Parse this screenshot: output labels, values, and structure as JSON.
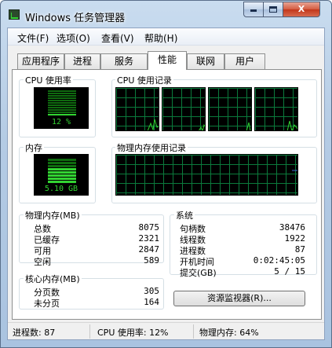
{
  "window": {
    "title": "Windows 任务管理器",
    "controls": {
      "minimize": "minimize",
      "maximize": "maximize",
      "close": "X"
    }
  },
  "menu": [
    "文件(F)",
    "选项(O)",
    "查看(V)",
    "帮助(H)"
  ],
  "tabs": [
    "应用程序",
    "进程",
    "服务",
    "性能",
    "联网",
    "用户"
  ],
  "active_tab": "性能",
  "cpu_usage": {
    "title": "CPU 使用率",
    "value": "12 %",
    "percent": 12
  },
  "cpu_history": {
    "title": "CPU 使用记录"
  },
  "memory": {
    "title": "内存",
    "value": "5.10 GB",
    "percent": 64
  },
  "memory_history": {
    "title": "物理内存使用记录"
  },
  "physical_memory": {
    "title": "物理内存(MB)",
    "rows": [
      {
        "label": "总数",
        "value": "8075"
      },
      {
        "label": "已缓存",
        "value": "2321"
      },
      {
        "label": "可用",
        "value": "2847"
      },
      {
        "label": "空闲",
        "value": "589"
      }
    ]
  },
  "kernel_memory": {
    "title": "核心内存(MB)",
    "rows": [
      {
        "label": "分页数",
        "value": "305"
      },
      {
        "label": "未分页",
        "value": "164"
      }
    ]
  },
  "system": {
    "title": "系统",
    "rows": [
      {
        "label": "句柄数",
        "value": "38476"
      },
      {
        "label": "线程数",
        "value": "1922"
      },
      {
        "label": "进程数",
        "value": "87"
      },
      {
        "label": "开机时间",
        "value": "0:02:45:05"
      },
      {
        "label": "提交(GB)",
        "value": "5 / 15"
      }
    ]
  },
  "resource_monitor_button": "资源监视器(R)...",
  "statusbar": {
    "processes": "进程数: 87",
    "cpu": "CPU 使用率: 12%",
    "memory": "物理内存: 64%"
  },
  "colors": {
    "graph_line": "#32d432",
    "graph_grid": "#0b7a3c",
    "memory_line": "#3b6bd6"
  }
}
